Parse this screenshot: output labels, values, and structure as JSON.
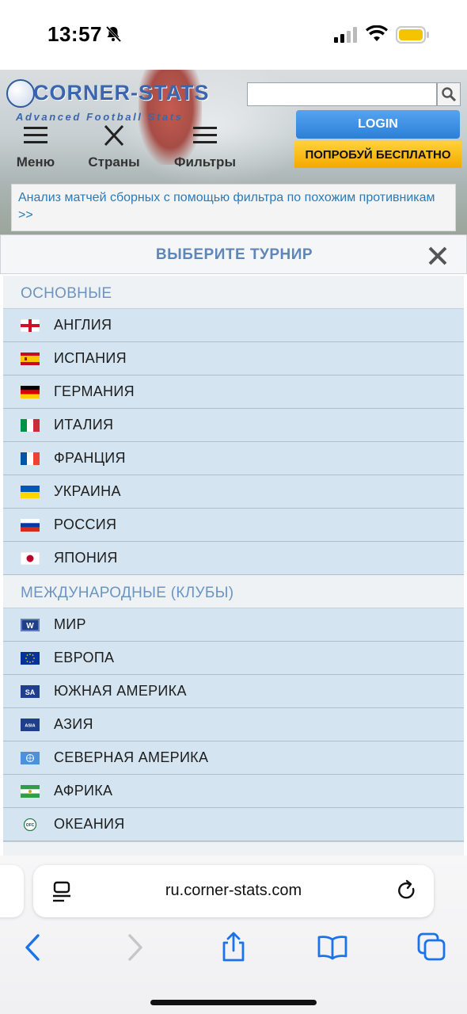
{
  "status_bar": {
    "time": "13:57"
  },
  "header": {
    "logo_text": "CORNER-STATS",
    "logo_tagline": "Advanced Football Stats",
    "login_label": "LOGIN",
    "trial_label": "ПОПРОБУЙ БЕСПЛАТНО",
    "nav": {
      "menu": "Меню",
      "countries": "Страны",
      "filters": "Фильтры"
    },
    "promo_text": "Анализ матчей сборных с помощью фильтра по похожим противникам >>"
  },
  "tournament_panel": {
    "title": "ВЫБЕРИТЕ ТУРНИР",
    "sections": [
      {
        "label": "ОСНОВНЫЕ",
        "items": [
          {
            "name": "АНГЛИЯ",
            "flag": "england"
          },
          {
            "name": "ИСПАНИЯ",
            "flag": "spain"
          },
          {
            "name": "ГЕРМАНИЯ",
            "flag": "germany"
          },
          {
            "name": "ИТАЛИЯ",
            "flag": "italy"
          },
          {
            "name": "ФРАНЦИЯ",
            "flag": "france"
          },
          {
            "name": "УКРАИНА",
            "flag": "ukraine"
          },
          {
            "name": "РОССИЯ",
            "flag": "russia"
          },
          {
            "name": "ЯПОНИЯ",
            "flag": "japan"
          }
        ]
      },
      {
        "label": "МЕЖДУНАРОДНЫЕ (КЛУБЫ)",
        "items": [
          {
            "name": "МИР",
            "flag": "world",
            "badge": "W"
          },
          {
            "name": "ЕВРОПА",
            "flag": "europe"
          },
          {
            "name": "ЮЖНАЯ АМЕРИКА",
            "flag": "south-america",
            "badge": "SA"
          },
          {
            "name": "АЗИЯ",
            "flag": "asia",
            "badge": "ASIA"
          },
          {
            "name": "СЕВЕРНАЯ АМЕРИКА",
            "flag": "north-america"
          },
          {
            "name": "АФРИКА",
            "flag": "africa"
          },
          {
            "name": "ОКЕАНИЯ",
            "flag": "oceania",
            "badge": "OFC"
          }
        ]
      }
    ]
  },
  "browser": {
    "url": "ru.corner-stats.com"
  },
  "colors": {
    "accent_blue": "#2a7fd8",
    "trial_yellow": "#f5a800",
    "row_bg": "#d4e5f1",
    "section_text": "#6b94c2"
  }
}
